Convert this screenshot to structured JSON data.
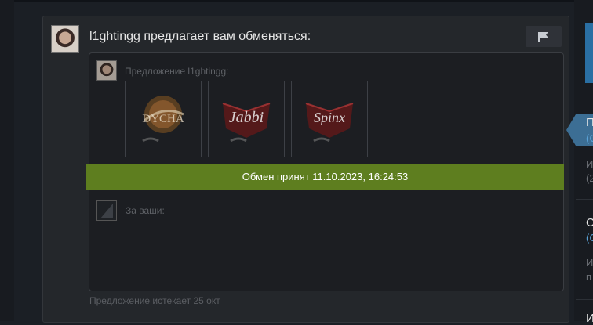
{
  "offer": {
    "header": "l1ghtingg предлагает вам обменяться:",
    "their_label": "Предложение l1ghtingg:",
    "status": "Обмен принят 11.10.2023, 16:24:53",
    "your_label": "За ваши:",
    "expires": "Предложение истекает 25 окт"
  },
  "items": [
    {
      "icon": "dycha-sticker-icon",
      "text": "DYCHA"
    },
    {
      "icon": "jabbi-sticker-icon",
      "text": "Jabbi"
    },
    {
      "icon": "spinx-sticker-icon",
      "text": "Spinx"
    }
  ],
  "right_sidebar": {
    "entry1": {
      "title": "П",
      "sub": "(С",
      "info1": "И",
      "info2": "(2"
    },
    "entry2": {
      "title": "С",
      "sub": "(С",
      "info1": "И",
      "info2": "п"
    },
    "entry3": {
      "title": "И"
    }
  },
  "colors": {
    "background": "#1b1f25",
    "panel": "#24272b",
    "accepted": "#5e7e1f",
    "link": "#5aa2d6"
  }
}
